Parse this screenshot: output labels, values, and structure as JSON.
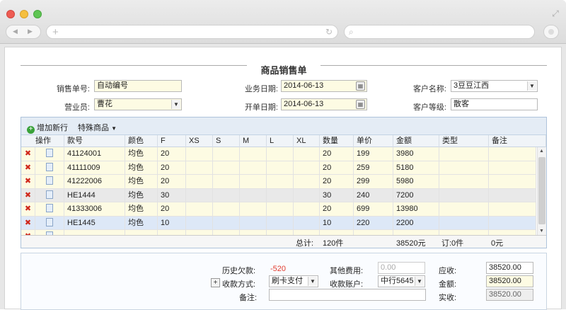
{
  "browser": {
    "back_icon": "◀",
    "forward_icon": "▶",
    "newtab_icon": "+",
    "reload_icon": "↻",
    "search_icon": "⌕",
    "resize_icon": "⤢"
  },
  "doc": {
    "title": "商品销售单"
  },
  "form": {
    "order_no_label": "销售单号:",
    "order_no_value": "自动编号",
    "biz_date_label": "业务日期:",
    "biz_date_value": "2014-06-13",
    "customer_label": "客户名称:",
    "customer_value": "3豆豆江西",
    "clerk_label": "营业员:",
    "clerk_value": "曹花",
    "open_date_label": "开单日期:",
    "open_date_value": "2014-06-13",
    "level_label": "客户等级:",
    "level_value": "散客"
  },
  "grid": {
    "add_row": "增加新行",
    "special": "特殊商品",
    "special_arrow": "▼",
    "columns": [
      "操作",
      "款号",
      "颜色",
      "F",
      "XS",
      "S",
      "M",
      "L",
      "XL",
      "数量",
      "单价",
      "金额",
      "类型",
      "备注"
    ],
    "rows": [
      {
        "code": "41124001",
        "color": "均色",
        "f": "20",
        "qty": "20",
        "price": "199",
        "amount": "3980"
      },
      {
        "code": "41111009",
        "color": "均色",
        "f": "20",
        "qty": "20",
        "price": "259",
        "amount": "5180"
      },
      {
        "code": "41222006",
        "color": "均色",
        "f": "20",
        "qty": "20",
        "price": "299",
        "amount": "5980"
      },
      {
        "code": "HE1444",
        "color": "均色",
        "f": "30",
        "qty": "30",
        "price": "240",
        "amount": "7200"
      },
      {
        "code": "41333006",
        "color": "均色",
        "f": "20",
        "qty": "20",
        "price": "699",
        "amount": "13980"
      },
      {
        "code": "HE1445",
        "color": "均色",
        "f": "10",
        "qty": "10",
        "price": "220",
        "amount": "2200"
      }
    ],
    "footer": {
      "total_label": "总计:",
      "total_qty": "120件",
      "total_amount": "38520元",
      "order_label": "订:0件",
      "zero": "0元"
    }
  },
  "summary": {
    "debt_label": "历史欠款:",
    "debt_value": "-520",
    "other_fee_label": "其他费用:",
    "other_fee_value": "0.00",
    "receivable_label": "应收:",
    "receivable_value": "38520.00",
    "pay_method_label": "收款方式:",
    "pay_method_value": "刷卡支付",
    "account_label": "收款账户:",
    "account_value": "中行5645",
    "amount_label": "金额:",
    "amount_value": "38520.00",
    "remark_label": "备注:",
    "actual_label": "实收:",
    "actual_value": "38520.00"
  },
  "colors": {
    "yellow_field": "#fdfbe3",
    "grid_border": "#aec3db",
    "debt_red": "#e23b2e"
  }
}
